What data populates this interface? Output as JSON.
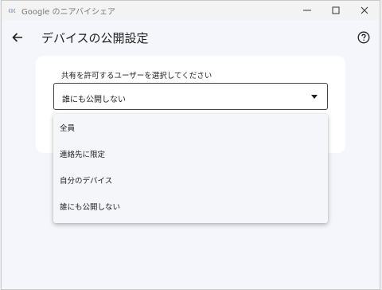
{
  "window": {
    "title": "Google のニアバイシェア"
  },
  "header": {
    "title": "デバイスの公開設定"
  },
  "visibility": {
    "label": "共有を許可するユーザーを選択してください",
    "selected": "誰にも公開しない",
    "options": [
      "全員",
      "連絡先に限定",
      "自分のデバイス",
      "誰にも公開しない"
    ]
  },
  "colors": {
    "background": "#f4f6fc",
    "card": "#ffffff",
    "menu": "#f4f6fa"
  }
}
